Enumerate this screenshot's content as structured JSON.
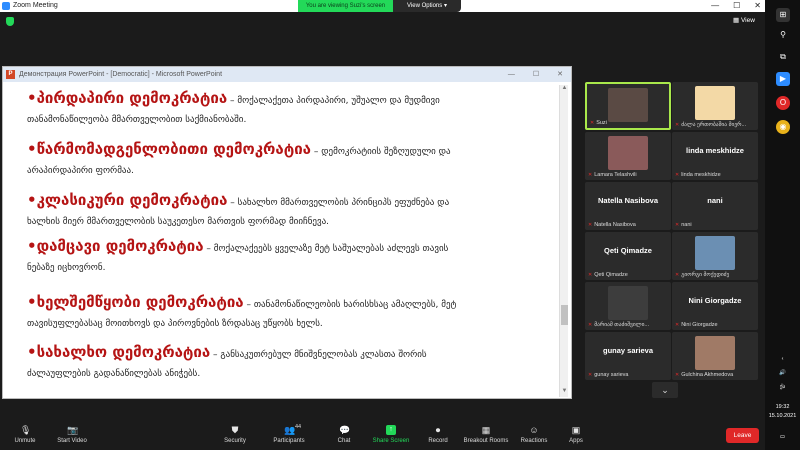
{
  "window": {
    "title": "Zoom Meeting",
    "min": "—",
    "max": "☐",
    "close": "✕"
  },
  "share_banner": {
    "text": "You are viewing Suzi's screen"
  },
  "view_options": {
    "label": "View Options ▾"
  },
  "view_button": {
    "label": "View"
  },
  "ppt": {
    "title": "Демонстрация PowerPoint - [Democratic] - Microsoft PowerPoint",
    "icon_letter": "P",
    "ctrl_min": "—",
    "ctrl_max": "☐",
    "ctrl_close": "✕",
    "paragraphs": [
      {
        "term": "•პირდაპირი დემოკრატია",
        "rest": " – მოქალაქეთა პირდაპირი, უშუალო და მუდმივი",
        "line2": "თანამონაწილეობა მმართველობით საქმიანობაში."
      },
      {
        "term": "•წარმომადგენლობითი დემოკრატია",
        "rest": " – დემოკრატიის შეზღუდული და",
        "line2": "არაპირდაპირი ფორმაა."
      },
      {
        "term": "•კლასიკური დემოკრატია",
        "rest": " – სახალხო მმართველობის პრინციპს ეფუძნება და",
        "line2": "ხალხის მიერ მმართველობის საუკეთესო მართვის ფორმად მიიჩნევა."
      },
      {
        "term": "•დამცავი დემოკრატია",
        "rest": " – მოქალაქეებს ყველაზე მეტ საშუალებას აძლევს თავის",
        "line2": "ნებაზე იცხოვრონ."
      },
      {
        "term": "•ხელშემწყობი დემოკრატია",
        "rest": " – თანამონაწილეობის ხარისხსაც ამაღლებს, მეტ",
        "line2": "თავისუფლებასაც მოითხოვს და პიროვნების ზრდასაც უწყობს ხელს."
      },
      {
        "term": "•სახალხო დემოკრატია",
        "rest": " – განსაკუთრებულ მნიშვნელობას კლასთა შორის",
        "line2": "ძალაუფლების გადანაწილებას ანიჭებს."
      }
    ]
  },
  "participants": [
    {
      "label": "Suzi",
      "name": "",
      "photo": "#5a4a44",
      "active": true
    },
    {
      "label": "ძალა ერთობაშია მიერ...",
      "name": "",
      "photo": "#f3d9a6",
      "active": false
    },
    {
      "label": "Lamara Telashvili",
      "name": "",
      "photo": "#8a5a5a",
      "active": false
    },
    {
      "label": "linda meskhidze",
      "name": "linda meskhidze",
      "photo": "",
      "active": false
    },
    {
      "label": "Natella Nasibova",
      "name": "Natella Nasibova",
      "photo": "",
      "active": false
    },
    {
      "label": "nani",
      "name": "nani",
      "photo": "",
      "active": false
    },
    {
      "label": "Qeti Qimadze",
      "name": "Qeti Qimadze",
      "photo": "",
      "active": false
    },
    {
      "label": "გიორგი მოქედიძე",
      "name": "",
      "photo": "#6b8fb3",
      "active": false
    },
    {
      "label": "მარიამ თაძიშვილი...",
      "name": "",
      "photo": "#3d3d3d",
      "active": false
    },
    {
      "label": "Nini Giorgadze",
      "name": "Nini Giorgadze",
      "photo": "",
      "active": false
    },
    {
      "label": "gunay sarieva",
      "name": "gunay sarieva",
      "photo": "",
      "active": false
    },
    {
      "label": "Gulchina Akhmedova",
      "name": "",
      "photo": "#a07a66",
      "active": false
    }
  ],
  "gallery_next": {
    "label": "⌄"
  },
  "toolbar": {
    "unmute": {
      "label": "Unmute",
      "icon": "microphone-muted-icon",
      "glyph": "🎙"
    },
    "video": {
      "label": "Start Video",
      "icon": "camera-off-icon",
      "glyph": "📷"
    },
    "security": {
      "label": "Security",
      "icon": "shield-icon",
      "glyph": "⛊"
    },
    "participants": {
      "label": "Participants",
      "count": "44",
      "icon": "people-icon",
      "glyph": "👥"
    },
    "chat": {
      "label": "Chat",
      "icon": "chat-icon",
      "glyph": "💬"
    },
    "share": {
      "label": "Share Screen",
      "icon": "share-screen-icon",
      "glyph": "↑"
    },
    "record": {
      "label": "Record",
      "icon": "record-icon",
      "glyph": "⏺"
    },
    "breakout": {
      "label": "Breakout Rooms",
      "icon": "breakout-icon",
      "glyph": "▦"
    },
    "reactions": {
      "label": "Reactions",
      "icon": "smiley-icon",
      "glyph": "☺"
    },
    "apps": {
      "label": "Apps",
      "icon": "apps-icon",
      "glyph": "▣"
    },
    "leave": {
      "label": "Leave"
    }
  },
  "taskbar": {
    "lang": "ქა",
    "time": "19:32",
    "date": "15.10.2021"
  },
  "colors": {
    "accent_green": "#23d959",
    "leave_red": "#e02828",
    "term_red": "#b51414"
  }
}
